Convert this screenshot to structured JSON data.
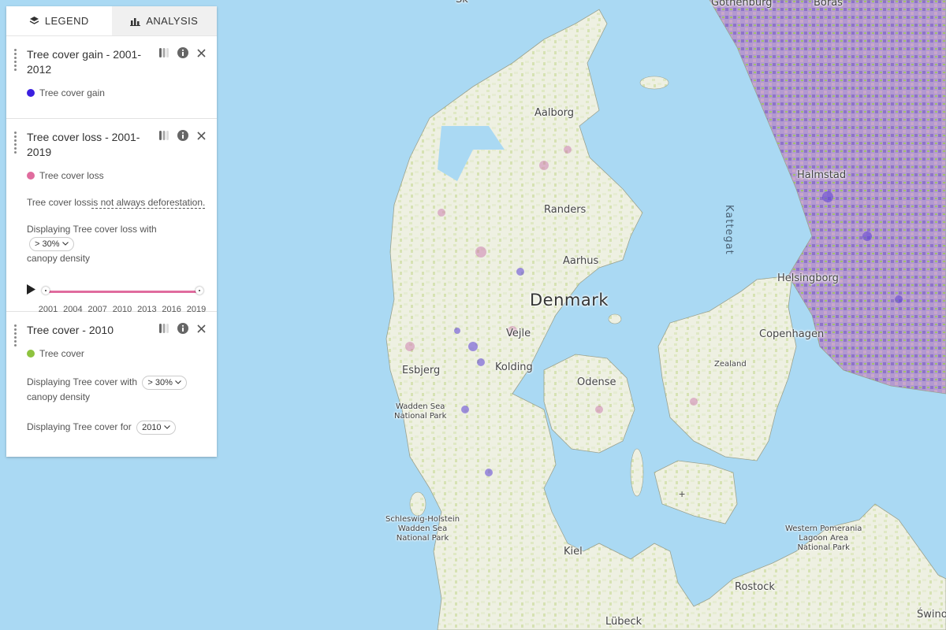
{
  "tabs": {
    "legend": "LEGEND",
    "analysis": "ANALYSIS"
  },
  "layers": [
    {
      "title": "Tree cover gain - 2001-2012",
      "legend_label": "Tree cover gain",
      "color": "#3b1fe0"
    },
    {
      "title": "Tree cover loss - 2001-2019",
      "legend_label": "Tree cover loss",
      "color": "#e06c9e",
      "note_prefix": "Tree cover loss",
      "note_link": "is not always deforestation.",
      "display_prefix": "Displaying Tree cover loss with",
      "display_suffix": "canopy density",
      "canopy": "> 30%",
      "timeline": {
        "start": "2001",
        "end": "2019",
        "ticks": [
          "2001",
          "2004",
          "2007",
          "2010",
          "2013",
          "2016",
          "2019"
        ]
      }
    },
    {
      "title": "Tree cover - 2010",
      "legend_label": "Tree cover",
      "color": "#8ec33f",
      "display_prefix": "Displaying Tree cover with",
      "display_suffix": "canopy density",
      "canopy": "> 30%",
      "year_prefix": "Displaying Tree cover for",
      "year": "2010"
    }
  ],
  "map": {
    "water_color": "#aad9f3",
    "land_color": "#eef0e2",
    "country": "Denmark",
    "cities": [
      "Gothenburg",
      "Borås",
      "Aalborg",
      "Halmstad",
      "Randers",
      "Aarhus",
      "Helsingborg",
      "Vejle",
      "Copenhagen",
      "Esbjerg",
      "Kolding",
      "Zealand",
      "Odense",
      "Kiel",
      "Rostock",
      "Lübeck",
      "Świno"
    ],
    "sea": "Kattegat",
    "parks": [
      [
        "Wadden Sea",
        "National Park"
      ],
      [
        "Schleswig-Holstein",
        "Wadden Sea",
        "National Park"
      ],
      [
        "Western Pomerania",
        "Lagoon Area",
        "National Park"
      ]
    ],
    "top_fragment": "Sk"
  }
}
